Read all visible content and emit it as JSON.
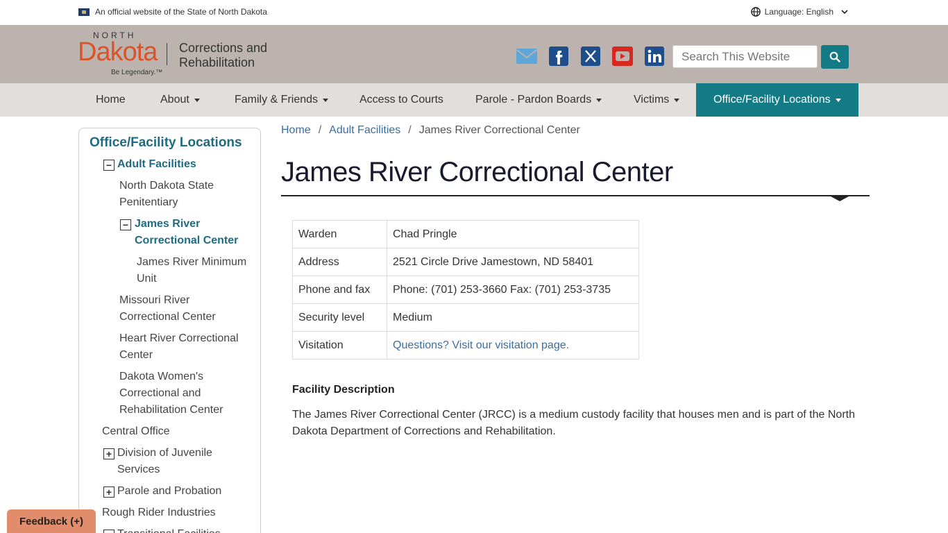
{
  "official": {
    "text": "An official website of the State of North Dakota"
  },
  "language": {
    "label": "Language: English"
  },
  "logo": {
    "north": "NORTH",
    "dakota": "Dakota",
    "tagline": "Be Legendary.™",
    "dept_line1": "Corrections and",
    "dept_line2": "Rehabilitation"
  },
  "socials": [
    {
      "icon": "email-icon",
      "color": "#5ea6d8"
    },
    {
      "icon": "facebook-icon",
      "color": "#1f4e8c"
    },
    {
      "icon": "x-twitter-icon",
      "color": "#1f4e8c"
    },
    {
      "icon": "youtube-icon",
      "color": "#d7291f"
    },
    {
      "icon": "linkedin-icon",
      "color": "#1f4e8c"
    }
  ],
  "search": {
    "placeholder": "Search This Website"
  },
  "nav": [
    {
      "label": "Home",
      "dropdown": false
    },
    {
      "label": "About",
      "dropdown": true
    },
    {
      "label": "Family & Friends",
      "dropdown": true
    },
    {
      "label": "Access to Courts",
      "dropdown": false
    },
    {
      "label": "Parole - Pardon Boards",
      "dropdown": true
    },
    {
      "label": "Victims",
      "dropdown": true
    },
    {
      "label": "Office/Facility Locations",
      "dropdown": true,
      "active": true
    }
  ],
  "sidebar": {
    "title": "Office/Facility Locations",
    "items": [
      {
        "label": "Adult Facilities"
      },
      {
        "label_1": "North Dakota State",
        "label_2": "Penitentiary"
      },
      {
        "label_1": "James River",
        "label_2": "Correctional Center"
      },
      {
        "label_1": "James River Minimum",
        "label_2": "Unit"
      },
      {
        "label_1": "Missouri River",
        "label_2": "Correctional Center"
      },
      {
        "label_1": "Heart River Correctional",
        "label_2": "Center"
      },
      {
        "label_1": "Dakota Women's",
        "label_2": "Correctional and",
        "label_3": "Rehabilitation Center"
      },
      {
        "label": "Central Office"
      },
      {
        "label_1": "Division of Juvenile",
        "label_2": "Services"
      },
      {
        "label": "Parole and Probation"
      },
      {
        "label": "Rough Rider Industries"
      },
      {
        "label": "Transitional Facilities"
      }
    ]
  },
  "breadcrumb": {
    "home": "Home",
    "sep": "/",
    "adult": "Adult Facilities",
    "current": "James River Correctional Center"
  },
  "page": {
    "title": "James River Correctional Center"
  },
  "info": [
    {
      "key": "Warden",
      "value": "Chad Pringle"
    },
    {
      "key": "Address",
      "value": "2521 Circle Drive Jamestown, ND 58401"
    },
    {
      "key": "Phone and fax",
      "value": "Phone: (701) 253-3660 Fax: (701) 253-3735"
    },
    {
      "key": "Security level",
      "value": "Medium"
    },
    {
      "key": "Visitation",
      "value": "Questions? Visit our visitation page."
    }
  ],
  "facility": {
    "heading": "Facility Description",
    "body": "The James River Correctional Center (JRCC) is a medium custody facility that houses men and is part of the North Dakota Department of Corrections and Rehabilitation."
  },
  "feedback": {
    "label": "Feedback (+)"
  }
}
